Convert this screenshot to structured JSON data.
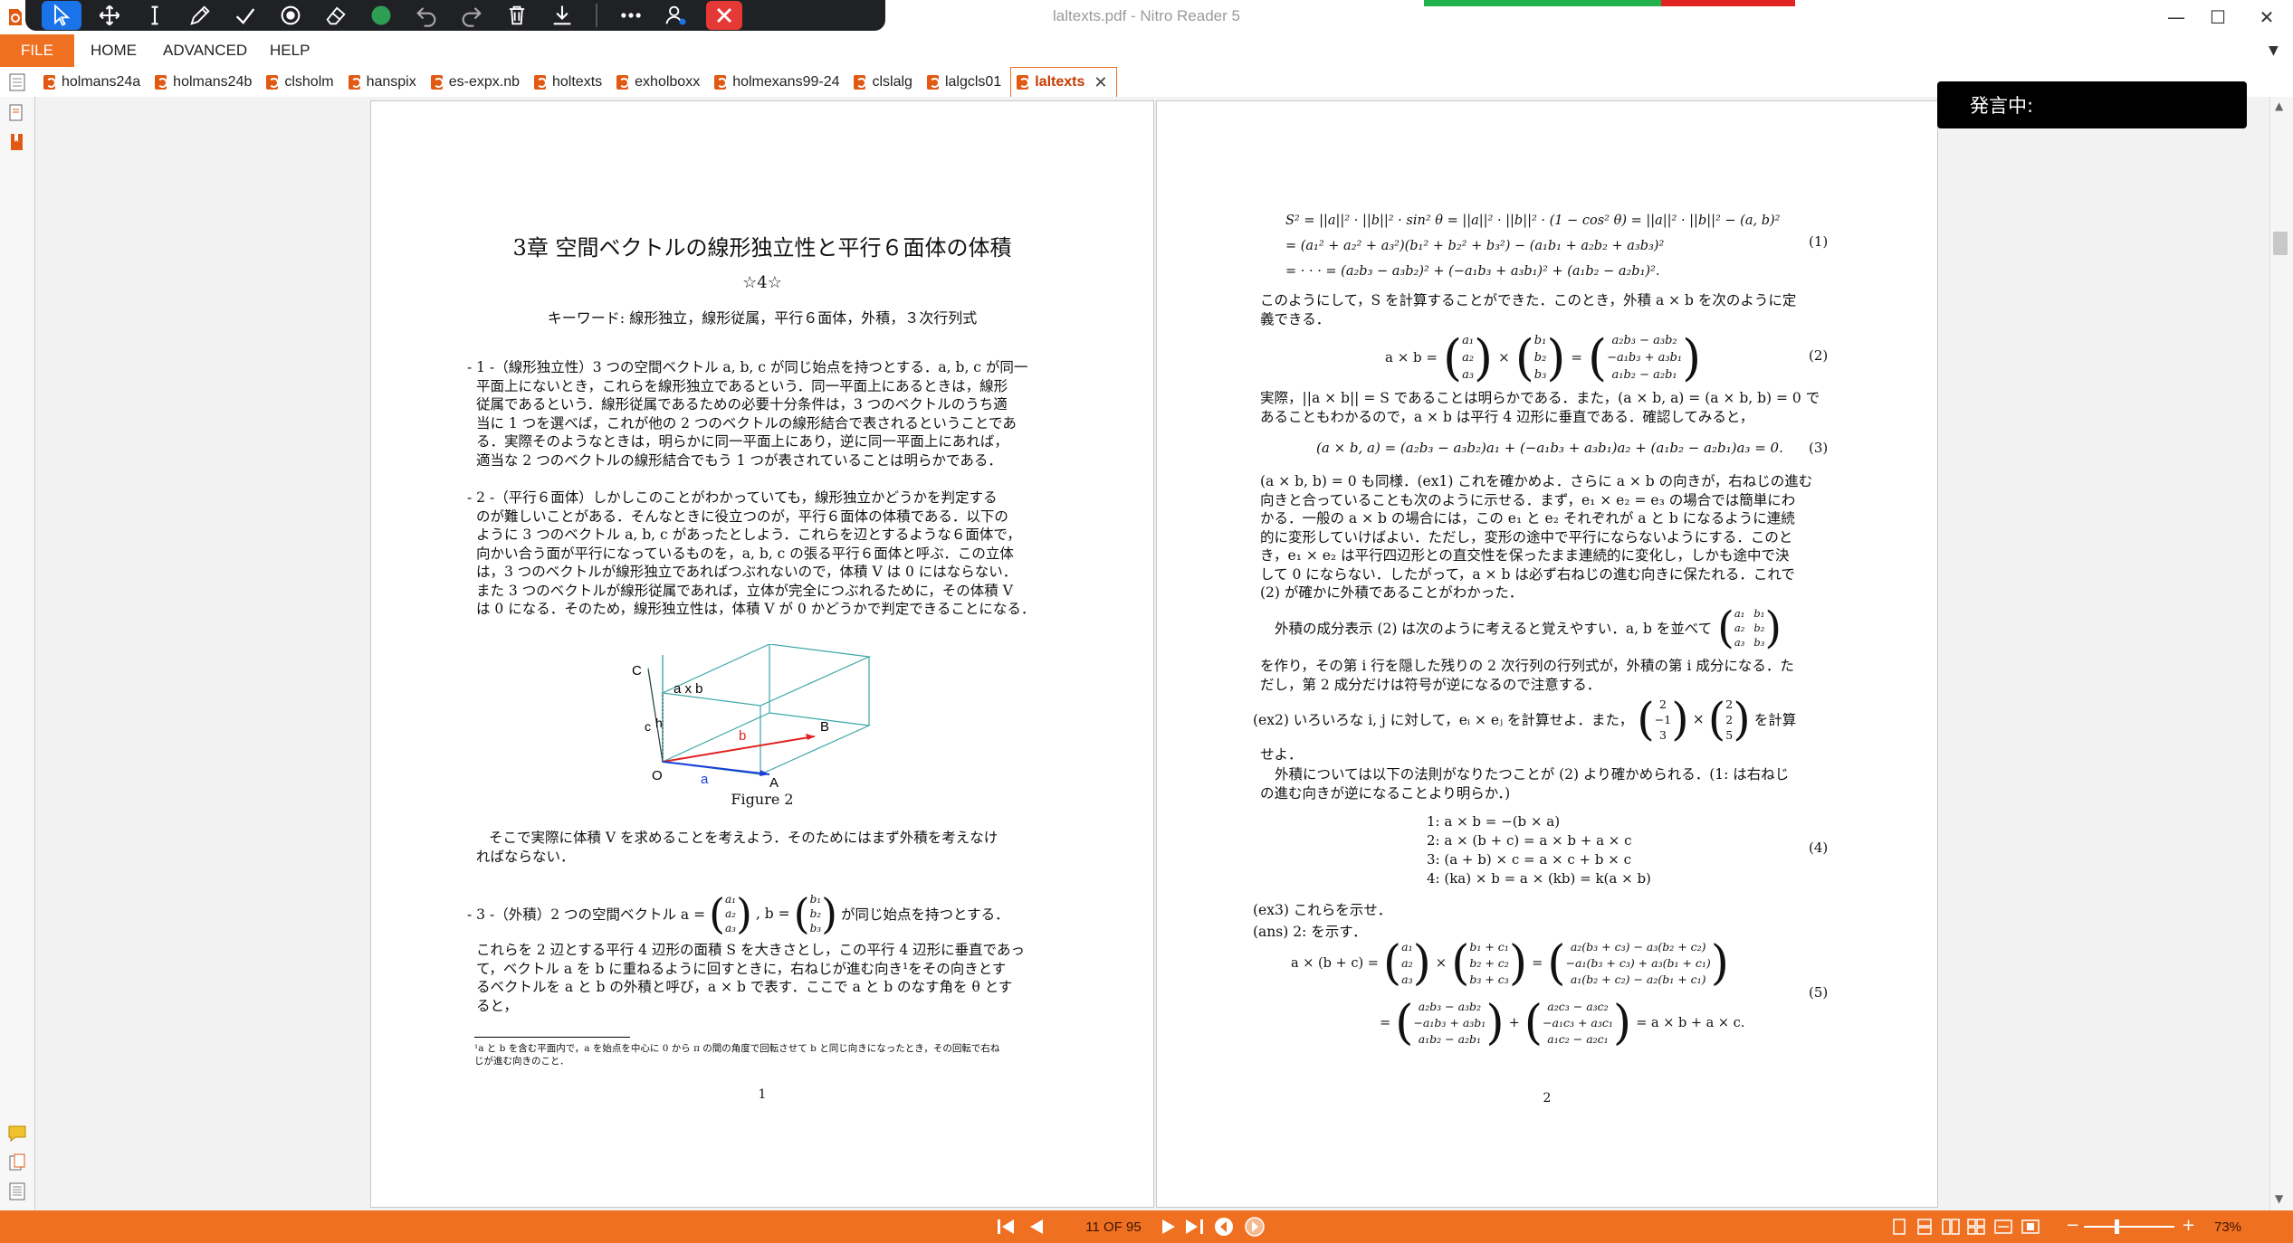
{
  "window": {
    "title": "laltexts.pdf - Nitro Reader 5",
    "minimize_glyph": "—",
    "maximize_glyph": "☐",
    "close_glyph": "✕"
  },
  "toolbar": {
    "tools": [
      "select-pointer",
      "pan-hand",
      "text-cursor",
      "pen",
      "check",
      "stamp",
      "eraser",
      "color-dot",
      "undo",
      "redo",
      "delete",
      "download",
      "more",
      "user-settings",
      "close"
    ],
    "accent": "#1a73e8"
  },
  "menu": {
    "file": "FILE",
    "items": [
      "HOME",
      "ADVANCED",
      "HELP"
    ]
  },
  "tabs": [
    {
      "label": "holmans24a"
    },
    {
      "label": "holmans24b"
    },
    {
      "label": "clsholm"
    },
    {
      "label": "hanspix"
    },
    {
      "label": "es-expx.nb"
    },
    {
      "label": "holtexts"
    },
    {
      "label": "exholboxx"
    },
    {
      "label": "holmexans99-24"
    },
    {
      "label": "clslalg"
    },
    {
      "label": "lalgcls01"
    },
    {
      "label": "laltexts",
      "active": true
    }
  ],
  "caption": {
    "text": "発言中:"
  },
  "status": {
    "page_indicator": "11 OF 95",
    "zoom": "73%",
    "accent": "#f07022"
  },
  "page1": {
    "title": "3章  空間ベクトルの線形独立性と平行６面体の体積",
    "stars": "☆4☆",
    "keywords": "キーワード: 線形独立，線形従属，平行６面体，外積，３次行列式",
    "sec1": [
      "- 1 -（線形独立性）3 つの空間ベクトル a, b, c が同じ始点を持つとする．a, b, c が同一",
      "平面上にないとき，これらを線形独立であるという．同一平面上にあるときは，線形",
      "従属であるという．線形従属であるための必要十分条件は，3 つのベクトルのうち適",
      "当に 1 つを選べば，これが他の 2 つのベクトルの線形結合で表されるということであ",
      "る．実際そのようなときは，明らかに同一平面上にあり，逆に同一平面上にあれば，",
      "適当な 2 つのベクトルの線形結合でもう 1 つが表されていることは明らかである．"
    ],
    "sec2": [
      "- 2 -（平行６面体）しかしこのことがわかっていても，線形独立かどうかを判定する",
      "のが難しいことがある．そんなときに役立つのが，平行６面体の体積である．以下の",
      "ように 3 つのベクトル a, b, c があったとしよう．これらを辺とするような６面体で，",
      "向かい合う面が平行になっているものを，a, b, c の張る平行６面体と呼ぶ．この立体",
      "は，3 つのベクトルが線形独立であればつぶれないので，体積 V は 0 にはならない．",
      "また 3 つのベクトルが線形従属であれば，立体が完全につぶれるために，その体積 V",
      "は 0 になる．そのため，線形独立性は，体積 V が 0 かどうかで判定できることになる．"
    ],
    "figure": {
      "caption": "Figure 2",
      "label_C": "C",
      "label_axb": "a x b",
      "label_c": "c",
      "label_h": "h",
      "label_b": "b",
      "label_B": "B",
      "label_O": "O",
      "label_a": "a",
      "label_A": "A"
    },
    "para3": [
      "そこで実際に体積 V を求めることを考えよう．そのためにはまず外積を考えなけ",
      "ればならない．"
    ],
    "sec3_head": "- 3 -（外積）2 つの空間ベクトル a =",
    "sec3_mid": ", b =",
    "sec3_tail": "が同じ始点を持つとする．",
    "vec_a": [
      "a₁",
      "a₂",
      "a₃"
    ],
    "vec_b": [
      "b₁",
      "b₂",
      "b₃"
    ],
    "sec3": [
      "これらを 2 辺とする平行 4 辺形の面積 S を大きさとし，この平行 4 辺形に垂直であっ",
      "て，ベクトル a を b に重ねるように回すときに，右ねじが進む向き¹をその向きとす",
      "るベクトルを a と b の外積と呼び，a × b で表す．ここで a と b のなす角を θ とす",
      "ると，"
    ],
    "footnote": [
      "¹a と b を含む平面内で，a を始点を中心に 0 から π の間の角度で回転させて b と同じ向きになったとき，その回転で右ね",
      "じが進む向きのこと．"
    ],
    "page_number": "1"
  },
  "page2": {
    "eq1": [
      "S² = ||a||² · ||b||² · sin² θ = ||a||² · ||b||² · (1 − cos² θ) = ||a||² · ||b||² − (a, b)²",
      "= (a₁² + a₂² + a₃²)(b₁² + b₂² + b₃²) − (a₁b₁ + a₂b₂ + a₃b₃)²",
      "= · · · = (a₂b₃ − a₃b₂)² + (−a₁b₃ + a₃b₁)² + (a₁b₂ − a₂b₁)²."
    ],
    "eq1_no": "(1)",
    "p1": [
      "このようにして，S を計算することができた．このとき，外積 a × b を次のように定",
      "義できる．"
    ],
    "eq2_lhs": "a × b =",
    "eq2_times": "×",
    "eq2_eq": "=",
    "eq2_rhs": [
      "a₂b₃ − a₃b₂",
      "−a₁b₃ + a₃b₁",
      "a₁b₂ − a₂b₁"
    ],
    "eq2_no": "(2)",
    "p2": [
      "実際，||a × b|| = S であることは明らかである．また，(a × b, a) = (a × b, b) = 0 で",
      "あることもわかるので，a × b は平行 4 辺形に垂直である．確認してみると，"
    ],
    "eq3": "(a × b, a) = (a₂b₃ − a₃b₂)a₁ + (−a₁b₃ + a₃b₁)a₂ + (a₁b₂ − a₂b₁)a₃ = 0.",
    "eq3_no": "(3)",
    "p3": [
      "(a × b, b) = 0 も同様．(ex1) これを確かめよ．さらに a × b の向きが，右ねじの進む",
      "向きと合っていることも次のように示せる．まず，e₁ × e₂ = e₃ の場合では簡単にわ",
      "かる．一般の a × b の場合には，この e₁ と e₂ それぞれが a と b になるように連続",
      "的に変形していけばよい．ただし，変形の途中で平行にならないようにする．このと",
      "き，e₁ × e₂ は平行四辺形との直交性を保ったまま連続的に変化し，しかも途中で決",
      "して 0 にならない．したがって，a × b は必ず右ねじの進む向きに保たれる．これで",
      "(2) が確かに外積であることがわかった．"
    ],
    "p4_head": "外積の成分表示 (2) は次のように考えると覚えやすい．a, b を並べて",
    "mat_ab": [
      [
        "a₁",
        "b₁"
      ],
      [
        "a₂",
        "b₂"
      ],
      [
        "a₃",
        "b₃"
      ]
    ],
    "p4": [
      "を作り，その第 i 行を隠した残りの 2 次行列の行列式が，外積の第 i 成分になる．た",
      "だし，第 2 成分だけは符号が逆になるので注意する．"
    ],
    "ex2_head": "(ex2) いろいろな i, j に対して，eᵢ × eⱼ を計算せよ．また，",
    "ex2_v1": [
      "2",
      "−1",
      "3"
    ],
    "ex2_times": "×",
    "ex2_v2": [
      "2",
      "2",
      "5"
    ],
    "ex2_tail": "を計算",
    "ex2_end": "せよ．",
    "p5": [
      "外積については以下の法則がなりたつことが (2) より確かめられる．(1: は右ねじ",
      "の進む向きが逆になることより明らか．)"
    ],
    "laws": [
      "1:   a × b = −(b × a)",
      "2:   a × (b + c) = a × b + a × c",
      "3:   (a + b) × c = a × c + b × c",
      "4:   (ka) × b = a × (kb) = k(a × b)"
    ],
    "eq4_no": "(4)",
    "ex3": "(ex3) これらを示せ．",
    "ans": "(ans) 2: を示す．",
    "eq5_lhs": "a × (b + c)  =",
    "eq5_v1": [
      "a₁",
      "a₂",
      "a₃"
    ],
    "eq5_v2": [
      "b₁ + c₁",
      "b₂ + c₂",
      "b₃ + c₃"
    ],
    "eq5_r1": [
      "a₂(b₃ + c₃) − a₃(b₂ + c₂)",
      "−a₁(b₃ + c₃) + a₃(b₁ + c₁)",
      "a₁(b₂ + c₂) − a₂(b₁ + c₁)"
    ],
    "eq5_eq2": "=",
    "eq5_r2a": [
      "a₂b₃ − a₃b₂",
      "−a₁b₃ + a₃b₁",
      "a₁b₂ − a₂b₁"
    ],
    "eq5_plus": "+",
    "eq5_r2b": [
      "a₂c₃ − a₃c₂",
      "−a₁c₃ + a₃c₁",
      "a₁c₂ − a₂c₁"
    ],
    "eq5_tail": "= a × b + a × c.",
    "eq5_no": "(5)",
    "page_number": "2"
  }
}
